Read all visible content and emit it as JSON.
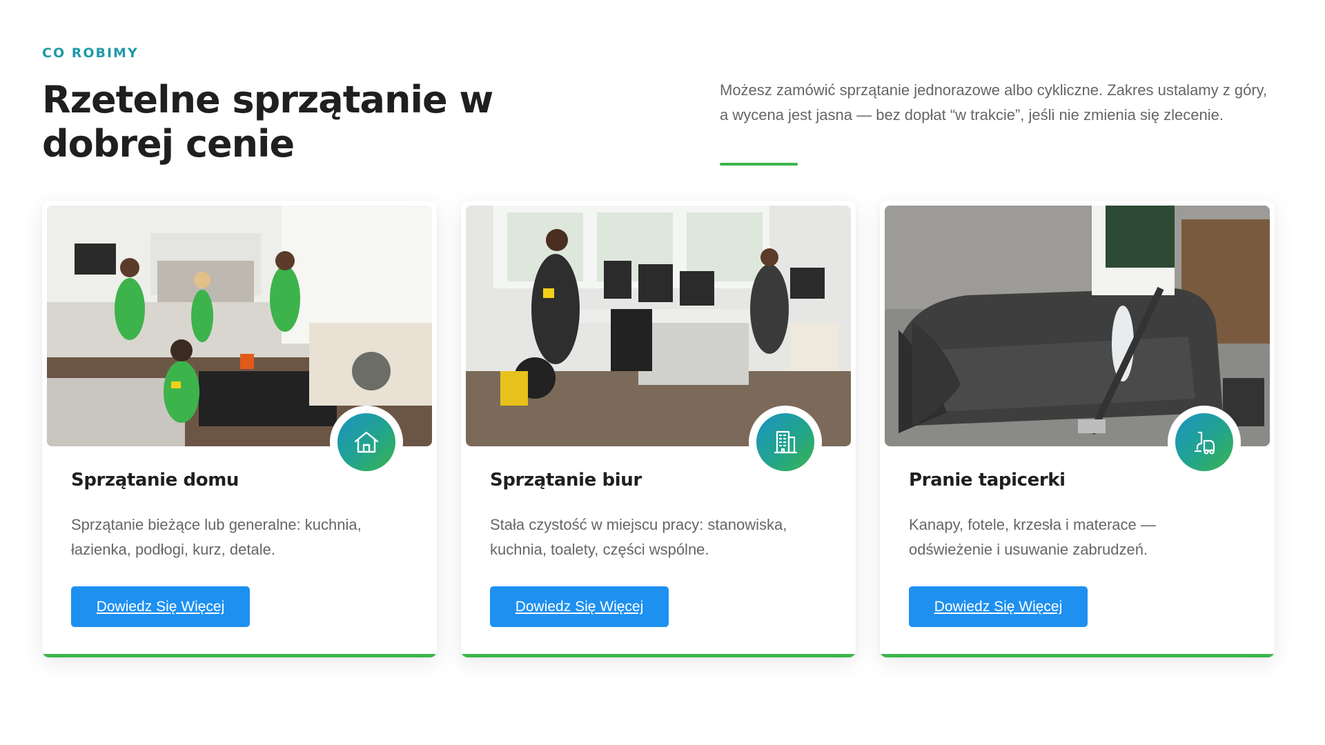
{
  "section": {
    "eyebrow": "CO ROBIMY",
    "title": "Rzetelne sprzątanie w dobrej cenie",
    "intro": "Możesz zamówić sprzątanie jednorazowe albo cykliczne. Zakres ustalamy z góry, a wycena jest jasna — bez dopłat “w trakcie”, jeśli nie zmienia się zlecenie."
  },
  "cards": [
    {
      "title": "Sprzątanie domu",
      "text": "Sprzątanie bieżące lub generalne: kuchnia, łazienka, podłogi, kurz, detale.",
      "button": "Dowiedz Się Więcej",
      "icon": "house-icon",
      "photo": "home-cleaning-team-photo"
    },
    {
      "title": "Sprzątanie biur",
      "text": "Stała czystość w miejscu pracy: stanowiska, kuchnia, toalety, części wspólne.",
      "button": "Dowiedz Się Więcej",
      "icon": "office-building-icon",
      "photo": "office-cleaning-photo"
    },
    {
      "title": "Pranie tapicerki",
      "text": "Kanapy, fotele, krzesła i materace — odświeżenie i usuwanie zabrudzeń.",
      "button": "Dowiedz Się Więcej",
      "icon": "vacuum-cleaner-icon",
      "photo": "upholstery-cleaning-photo"
    }
  ],
  "colors": {
    "eyebrow": "#1d9aa8",
    "accent_line": "#3cb54a",
    "button": "#1e90f0",
    "icon_gradient_start": "#1b93c4",
    "icon_gradient_end": "#3cb54a"
  }
}
